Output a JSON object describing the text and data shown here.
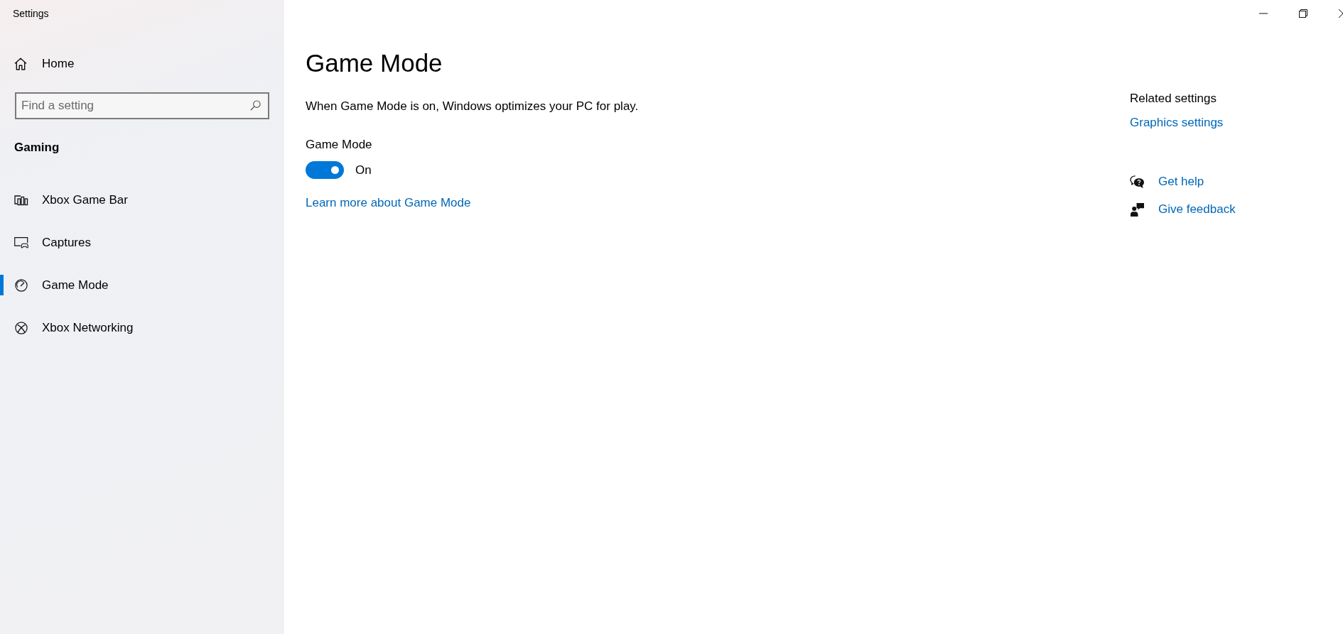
{
  "window": {
    "title": "Settings"
  },
  "sidebar": {
    "home": {
      "label": "Home"
    },
    "search": {
      "placeholder": "Find a setting"
    },
    "section": "Gaming",
    "items": [
      {
        "kind": "game-bar",
        "label": "Xbox Game Bar",
        "selected": false
      },
      {
        "kind": "captures",
        "label": "Captures",
        "selected": false
      },
      {
        "kind": "game-mode",
        "label": "Game Mode",
        "selected": true
      },
      {
        "kind": "networking",
        "label": "Xbox Networking",
        "selected": false
      }
    ]
  },
  "page": {
    "title": "Game Mode",
    "description": "When Game Mode is on, Windows optimizes your PC for play.",
    "toggle": {
      "label": "Game Mode",
      "on": true,
      "state_text": "On"
    },
    "link": "Learn more about Game Mode"
  },
  "related": {
    "title": "Related settings",
    "links": [
      "Graphics settings"
    ]
  },
  "support": [
    {
      "kind": "help",
      "label": "Get help"
    },
    {
      "kind": "feedback",
      "label": "Give feedback"
    }
  ]
}
